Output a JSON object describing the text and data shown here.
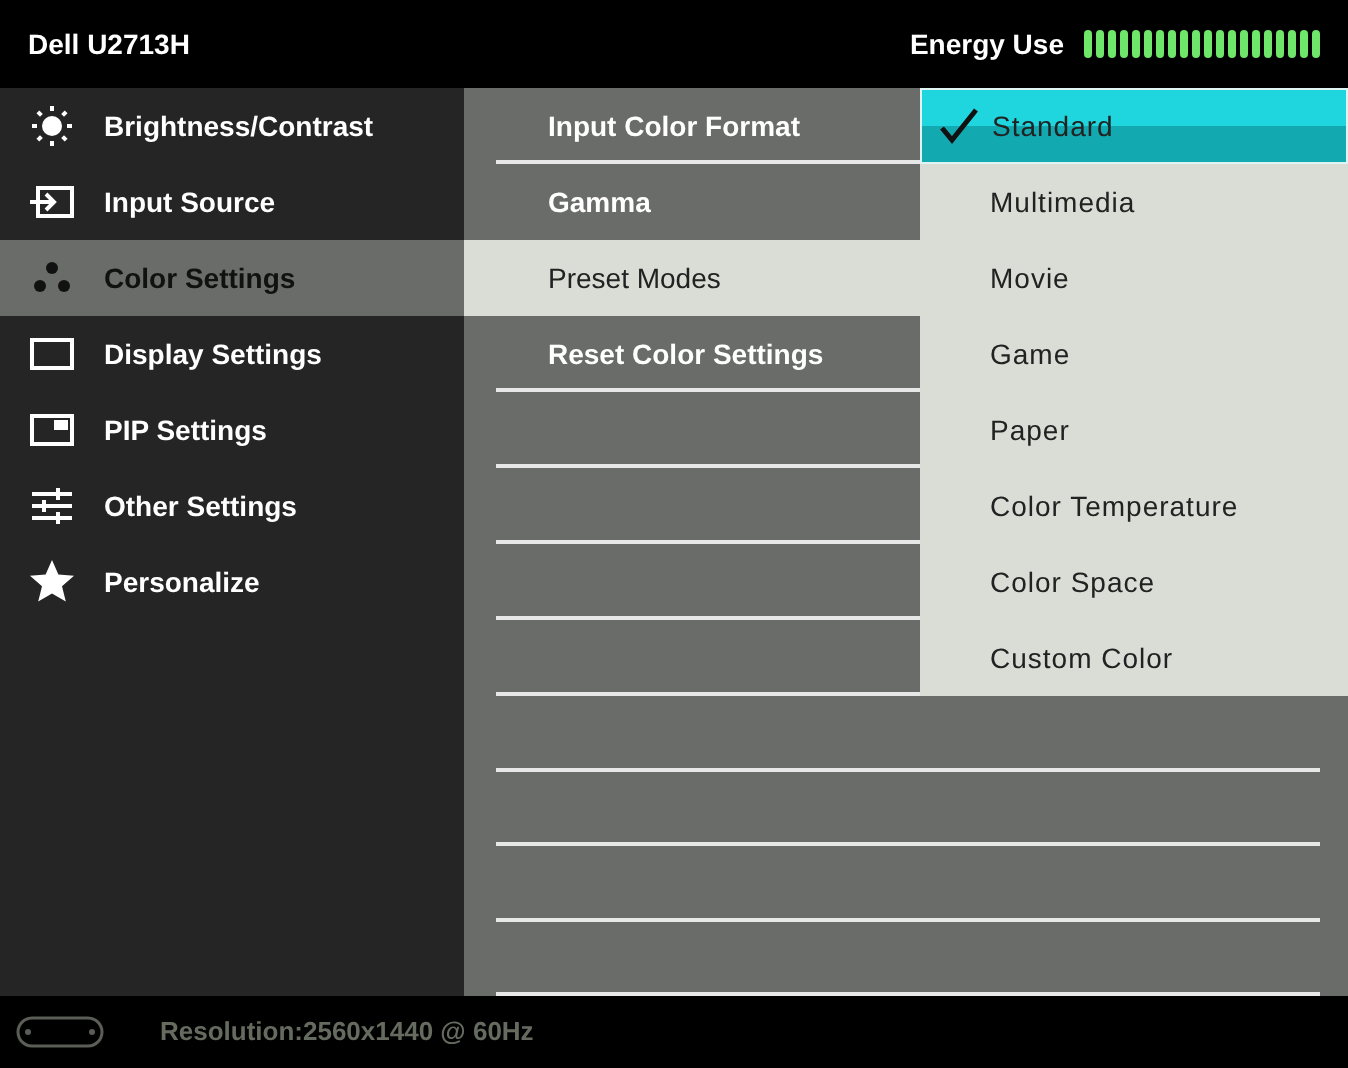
{
  "header": {
    "title": "Dell U2713H",
    "energy_label": "Energy Use",
    "energy": {
      "level": 1
    }
  },
  "sidebar": {
    "items": [
      {
        "label": "Brightness/Contrast",
        "kind": "sun",
        "selected": false
      },
      {
        "label": "Input Source",
        "kind": "input",
        "selected": false
      },
      {
        "label": "Color Settings",
        "kind": "dots",
        "selected": true
      },
      {
        "label": "Display Settings",
        "kind": "display",
        "selected": false
      },
      {
        "label": "PIP Settings",
        "kind": "pip",
        "selected": false
      },
      {
        "label": "Other Settings",
        "kind": "sliders",
        "selected": false
      },
      {
        "label": "Personalize",
        "kind": "star",
        "selected": false
      }
    ]
  },
  "submenu": {
    "items": [
      {
        "label": "Input Color Format",
        "selected": false
      },
      {
        "label": "Gamma",
        "selected": false
      },
      {
        "label": "Preset Modes",
        "selected": true
      },
      {
        "label": "Reset Color Settings",
        "selected": false
      }
    ]
  },
  "options": {
    "items": [
      {
        "label": "Standard",
        "checked": true,
        "selected": true
      },
      {
        "label": "Multimedia",
        "checked": false,
        "selected": false
      },
      {
        "label": "Movie",
        "checked": false,
        "selected": false
      },
      {
        "label": "Game",
        "checked": false,
        "selected": false
      },
      {
        "label": "Paper",
        "checked": false,
        "selected": false
      },
      {
        "label": "Color Temperature",
        "checked": false,
        "selected": false
      },
      {
        "label": "Color Space",
        "checked": false,
        "selected": false
      },
      {
        "label": "Custom Color",
        "checked": false,
        "selected": false
      }
    ]
  },
  "status_bar": {
    "resolution": "Resolution:2560x1440 @ 60Hz"
  }
}
